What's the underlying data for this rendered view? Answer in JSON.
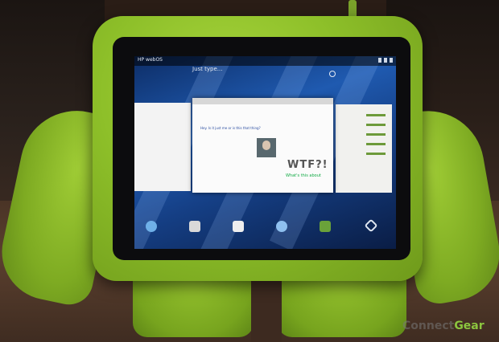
{
  "tablet": {
    "status_title": "HP webOS",
    "search_placeholder": "Just type...",
    "card_text": "Hey. Is it just me or is this that thing?",
    "card_wtf": "WTF?!",
    "card_sub": "What's this about"
  },
  "watermark": {
    "prefix": "Connect",
    "brand": "Gear"
  },
  "colors": {
    "case_green": "#8dbf29",
    "screen_blue": "#1f5ab0"
  }
}
